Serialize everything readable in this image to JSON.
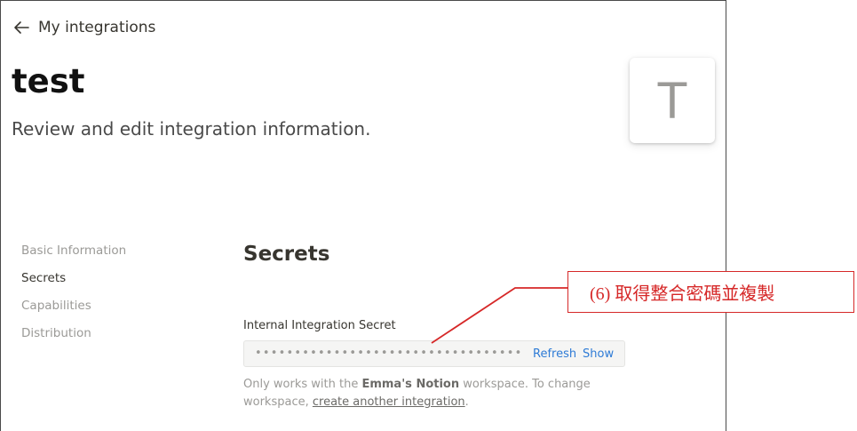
{
  "header": {
    "back_label": "My integrations",
    "title": "test",
    "subtitle": "Review and edit integration information.",
    "avatar_letter": "T"
  },
  "nav": {
    "items": [
      {
        "label": "Basic Information",
        "active": false
      },
      {
        "label": "Secrets",
        "active": true
      },
      {
        "label": "Capabilities",
        "active": false
      },
      {
        "label": "Distribution",
        "active": false
      }
    ]
  },
  "secrets": {
    "section_title": "Secrets",
    "field_label": "Internal Integration Secret",
    "masked_value": "••••••••••••••••••••••••••••••••••••",
    "refresh_label": "Refresh",
    "show_label": "Show",
    "help_prefix": "Only works with the ",
    "workspace_name": "Emma's Notion",
    "help_middle": " workspace. To change workspace, ",
    "help_link": "create another integration",
    "help_suffix": "."
  },
  "annotation": {
    "text": "(6) 取得整合密碼並複製",
    "color": "#d62828"
  },
  "icons": {
    "back": "arrow-left-icon"
  }
}
